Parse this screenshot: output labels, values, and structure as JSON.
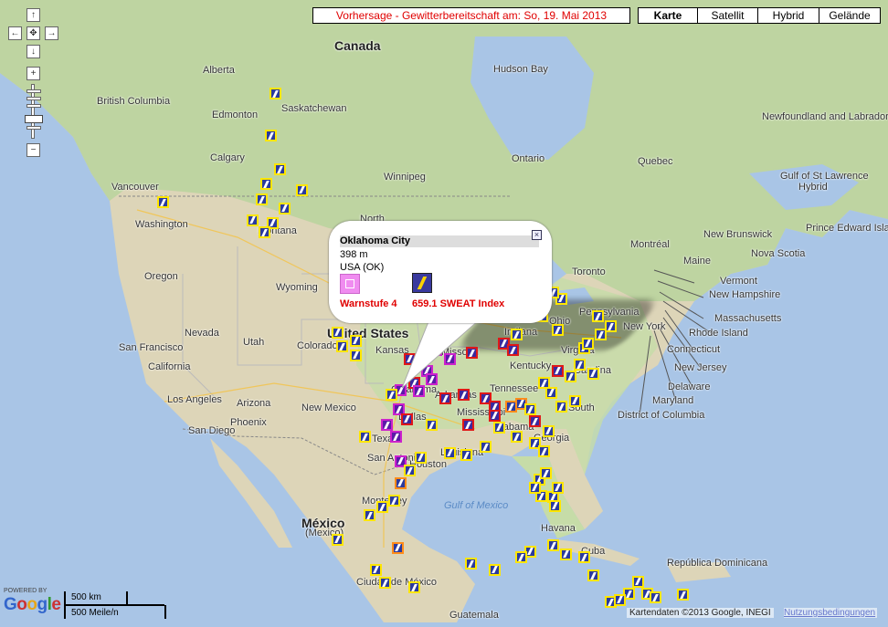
{
  "forecast_title": "Vorhersage - Gewitterbereitschaft am: So, 19. Mai 2013",
  "map_types": [
    "Karte",
    "Satellit",
    "Hybrid",
    "Gelände"
  ],
  "active_map_type": "Karte",
  "nav": {
    "up": "↑",
    "down": "↓",
    "left": "←",
    "right": "→",
    "center": "✥",
    "zoom_in": "+",
    "zoom_out": "−"
  },
  "popup": {
    "station": "Oklahoma City",
    "altitude": "398 m",
    "country": "USA (OK)",
    "warn_label": "Warnstufe 4",
    "sweat_label": "659.1  SWEAT Index",
    "close": "×"
  },
  "labels": [
    {
      "text": "Canada",
      "big": true
    },
    {
      "text": "United States",
      "big": true
    },
    {
      "text": "México",
      "big": true
    },
    {
      "text": "(Mexico)"
    },
    {
      "text": "Alberta"
    },
    {
      "text": "British Columbia"
    },
    {
      "text": "Edmonton"
    },
    {
      "text": "Saskatchewan"
    },
    {
      "text": "Calgary"
    },
    {
      "text": "Vancouver"
    },
    {
      "text": "Washington"
    },
    {
      "text": "Montana"
    },
    {
      "text": "Winnipeg"
    },
    {
      "text": "Oregon"
    },
    {
      "text": "Wyoming"
    },
    {
      "text": "Nevada"
    },
    {
      "text": "Utah"
    },
    {
      "text": "San Francisco"
    },
    {
      "text": "California"
    },
    {
      "text": "Los Angeles"
    },
    {
      "text": "San Diego"
    },
    {
      "text": "Arizona"
    },
    {
      "text": "Phoenix"
    },
    {
      "text": "New Mexico"
    },
    {
      "text": "Colorado"
    },
    {
      "text": "Kansas"
    },
    {
      "text": "Oklahoma"
    },
    {
      "text": "Texas"
    },
    {
      "text": "Dallas"
    },
    {
      "text": "San Antonio"
    },
    {
      "text": "Houston"
    },
    {
      "text": "Louisiana"
    },
    {
      "text": "Mississippi"
    },
    {
      "text": "Alabama"
    },
    {
      "text": "Georgia"
    },
    {
      "text": "Arkansas"
    },
    {
      "text": "Missouri"
    },
    {
      "text": "Kentucky"
    },
    {
      "text": "Indiana"
    },
    {
      "text": "Ohio"
    },
    {
      "text": "Pennsylvania"
    },
    {
      "text": "New York"
    },
    {
      "text": "Virginia"
    },
    {
      "text": "Carolina"
    },
    {
      "text": "South"
    },
    {
      "text": "Montréal"
    },
    {
      "text": "Toronto"
    },
    {
      "text": "Maine"
    },
    {
      "text": "Vermont"
    },
    {
      "text": "New Hampshire"
    },
    {
      "text": "Massachusetts"
    },
    {
      "text": "Rhode Island"
    },
    {
      "text": "Connecticut"
    },
    {
      "text": "New Jersey"
    },
    {
      "text": "Delaware"
    },
    {
      "text": "Maryland"
    },
    {
      "text": "District of Columbia"
    },
    {
      "text": "Ontario"
    },
    {
      "text": "Quebec"
    },
    {
      "text": "Newfoundland and Labrador"
    },
    {
      "text": "Gulf of St Lawrence"
    },
    {
      "text": "Hybrid"
    },
    {
      "text": "Prince Edward Island"
    },
    {
      "text": "New Brunswick"
    },
    {
      "text": "Nova Scotia"
    },
    {
      "text": "Hudson Bay"
    },
    {
      "text": "Gulf of Mexico",
      "water": true
    },
    {
      "text": "Havana"
    },
    {
      "text": "Cuba"
    },
    {
      "text": "República Dominicana"
    },
    {
      "text": "Ciudad de México"
    },
    {
      "text": "Guatemala"
    },
    {
      "text": "Monterrey"
    },
    {
      "text": "North"
    },
    {
      "text": "Tennessee"
    }
  ],
  "markers": [
    {
      "lon": -111.5,
      "lat": 60.0,
      "w": 0
    },
    {
      "lon": -112.0,
      "lat": 56.5,
      "w": 0
    },
    {
      "lon": -111.0,
      "lat": 53.7,
      "w": 0
    },
    {
      "lon": -112.5,
      "lat": 52.5,
      "w": 0
    },
    {
      "lon": -113.0,
      "lat": 51.2,
      "w": 0
    },
    {
      "lon": -110.5,
      "lat": 50.5,
      "w": 0
    },
    {
      "lon": -114.0,
      "lat": 49.5,
      "w": 0
    },
    {
      "lon": -111.8,
      "lat": 49.3,
      "w": 0
    },
    {
      "lon": -112.7,
      "lat": 48.5,
      "w": 0
    },
    {
      "lon": -108.5,
      "lat": 52.0,
      "w": 0
    },
    {
      "lon": -124.0,
      "lat": 51.0,
      "w": 0
    },
    {
      "lon": -104.0,
      "lat": 39.0,
      "w": 0
    },
    {
      "lon": -104.5,
      "lat": 40.2,
      "w": 0
    },
    {
      "lon": -102.5,
      "lat": 39.5,
      "w": 0
    },
    {
      "lon": -102.5,
      "lat": 38.3,
      "w": 0
    },
    {
      "lon": -96.5,
      "lat": 38.0,
      "w": 2
    },
    {
      "lon": -93.5,
      "lat": 38.7,
      "w": 3
    },
    {
      "lon": -89.5,
      "lat": 38.5,
      "w": 2
    },
    {
      "lon": -86.0,
      "lat": 39.3,
      "w": 2
    },
    {
      "lon": -85.0,
      "lat": 38.7,
      "w": 2
    },
    {
      "lon": -92.0,
      "lat": 38.0,
      "w": 3
    },
    {
      "lon": -94.5,
      "lat": 37.0,
      "w": 3
    },
    {
      "lon": -97.5,
      "lat": 35.4,
      "w": 3
    },
    {
      "lon": -96.0,
      "lat": 36.0,
      "w": 2
    },
    {
      "lon": -95.5,
      "lat": 35.3,
      "w": 3
    },
    {
      "lon": -94.0,
      "lat": 36.3,
      "w": 3
    },
    {
      "lon": -98.5,
      "lat": 35.0,
      "w": 0
    },
    {
      "lon": -97.7,
      "lat": 33.8,
      "w": 3
    },
    {
      "lon": -96.8,
      "lat": 33.0,
      "w": 2
    },
    {
      "lon": -99.0,
      "lat": 32.5,
      "w": 3
    },
    {
      "lon": -101.5,
      "lat": 31.5,
      "w": 0
    },
    {
      "lon": -98.0,
      "lat": 31.5,
      "w": 3
    },
    {
      "lon": -94.0,
      "lat": 32.5,
      "w": 0
    },
    {
      "lon": -92.5,
      "lat": 34.7,
      "w": 2
    },
    {
      "lon": -90.5,
      "lat": 35.0,
      "w": 2
    },
    {
      "lon": -88.0,
      "lat": 34.7,
      "w": 2
    },
    {
      "lon": -87.0,
      "lat": 34.0,
      "w": 2
    },
    {
      "lon": -90.0,
      "lat": 32.5,
      "w": 2
    },
    {
      "lon": -87.0,
      "lat": 33.3,
      "w": 2
    },
    {
      "lon": -86.5,
      "lat": 32.3,
      "w": 0
    },
    {
      "lon": -85.2,
      "lat": 34.0,
      "w": 1
    },
    {
      "lon": -84.0,
      "lat": 34.3,
      "w": 1
    },
    {
      "lon": -83.0,
      "lat": 33.8,
      "w": 0
    },
    {
      "lon": -82.5,
      "lat": 32.8,
      "w": 2
    },
    {
      "lon": -81.0,
      "lat": 32.0,
      "w": 0
    },
    {
      "lon": -84.5,
      "lat": 31.5,
      "w": 0
    },
    {
      "lon": -82.5,
      "lat": 31.0,
      "w": 0
    },
    {
      "lon": -81.5,
      "lat": 30.3,
      "w": 0
    },
    {
      "lon": -88.0,
      "lat": 30.7,
      "w": 0
    },
    {
      "lon": -90.2,
      "lat": 30.0,
      "w": 0
    },
    {
      "lon": -92.0,
      "lat": 30.2,
      "w": 0
    },
    {
      "lon": -95.3,
      "lat": 29.8,
      "w": 0
    },
    {
      "lon": -97.5,
      "lat": 29.5,
      "w": 3
    },
    {
      "lon": -96.5,
      "lat": 28.7,
      "w": 0
    },
    {
      "lon": -97.5,
      "lat": 27.7,
      "w": 1
    },
    {
      "lon": -98.2,
      "lat": 26.2,
      "w": 0
    },
    {
      "lon": -99.5,
      "lat": 25.7,
      "w": 0
    },
    {
      "lon": -101.0,
      "lat": 25.0,
      "w": 0
    },
    {
      "lon": -104.5,
      "lat": 23.0,
      "w": 0
    },
    {
      "lon": -97.8,
      "lat": 22.3,
      "w": 1
    },
    {
      "lon": -100.3,
      "lat": 20.5,
      "w": 0
    },
    {
      "lon": -99.2,
      "lat": 19.4,
      "w": 0
    },
    {
      "lon": -96.0,
      "lat": 19.0,
      "w": 0
    },
    {
      "lon": -98.8,
      "lat": 17.0,
      "w": 0
    },
    {
      "lon": -92.5,
      "lat": 16.8,
      "w": 0
    },
    {
      "lon": -89.6,
      "lat": 21.0,
      "w": 0
    },
    {
      "lon": -87.0,
      "lat": 20.5,
      "w": 0
    },
    {
      "lon": -83.0,
      "lat": 22.0,
      "w": 0
    },
    {
      "lon": -80.5,
      "lat": 22.5,
      "w": 0
    },
    {
      "lon": -77.0,
      "lat": 21.5,
      "w": 0
    },
    {
      "lon": -76.0,
      "lat": 20.0,
      "w": 0
    },
    {
      "lon": -82.0,
      "lat": 28.0,
      "w": 0
    },
    {
      "lon": -81.3,
      "lat": 28.5,
      "w": 0
    },
    {
      "lon": -80.5,
      "lat": 26.5,
      "w": 0
    },
    {
      "lon": -80.3,
      "lat": 25.8,
      "w": 0
    },
    {
      "lon": -81.8,
      "lat": 26.6,
      "w": 0
    },
    {
      "lon": -82.5,
      "lat": 27.3,
      "w": 0
    },
    {
      "lon": -80.0,
      "lat": 27.3,
      "w": 0
    },
    {
      "lon": -79.5,
      "lat": 34.0,
      "w": 0
    },
    {
      "lon": -78.0,
      "lat": 34.5,
      "w": 0
    },
    {
      "lon": -78.5,
      "lat": 36.5,
      "w": 0
    },
    {
      "lon": -77.5,
      "lat": 37.5,
      "w": 0
    },
    {
      "lon": -80.0,
      "lat": 37.0,
      "w": 2
    },
    {
      "lon": -80.7,
      "lat": 35.2,
      "w": 0
    },
    {
      "lon": -81.5,
      "lat": 36.0,
      "w": 0
    },
    {
      "lon": -76.0,
      "lat": 36.8,
      "w": 0
    },
    {
      "lon": -77.0,
      "lat": 38.9,
      "w": 0
    },
    {
      "lon": -76.6,
      "lat": 39.3,
      "w": 0
    },
    {
      "lon": -75.2,
      "lat": 40.0,
      "w": 0
    },
    {
      "lon": -74.0,
      "lat": 40.7,
      "w": 0
    },
    {
      "lon": -75.5,
      "lat": 41.5,
      "w": 0
    },
    {
      "lon": -79.5,
      "lat": 43.0,
      "w": 0
    },
    {
      "lon": -80.5,
      "lat": 43.5,
      "w": 0
    },
    {
      "lon": -82.5,
      "lat": 42.5,
      "w": 0
    },
    {
      "lon": -83.0,
      "lat": 41.7,
      "w": 0
    },
    {
      "lon": -84.5,
      "lat": 40.0,
      "w": 0
    },
    {
      "lon": -81.7,
      "lat": 41.5,
      "w": 0
    },
    {
      "lon": -80.0,
      "lat": 40.4,
      "w": 0
    },
    {
      "lon": -72.0,
      "lat": 18.5,
      "w": 0
    },
    {
      "lon": -70.0,
      "lat": 18.5,
      "w": 0
    },
    {
      "lon": -69.0,
      "lat": 18.2,
      "w": 0
    },
    {
      "lon": -66.0,
      "lat": 18.4,
      "w": 0
    },
    {
      "lon": -61.0,
      "lat": 14.0,
      "w": 0
    },
    {
      "lon": -74.0,
      "lat": 17.8,
      "w": 0
    },
    {
      "lon": -73.0,
      "lat": 18.0,
      "w": 0
    },
    {
      "lon": -71.0,
      "lat": 19.5,
      "w": 0
    },
    {
      "lon": -79.0,
      "lat": 21.8,
      "w": 0
    },
    {
      "lon": -84.0,
      "lat": 21.5,
      "w": 0
    }
  ]
}
